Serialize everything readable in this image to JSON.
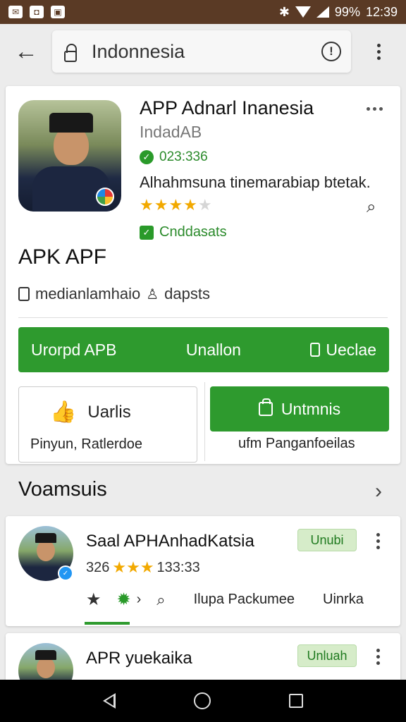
{
  "status_bar": {
    "left_icons": [
      "notification-icon",
      "photo-icon",
      "message-icon"
    ],
    "battery": "99%",
    "time": "12:39"
  },
  "appbar": {
    "search_text": "Indonnesia"
  },
  "app": {
    "title": "APP Adnarl Inanesia",
    "subtitle": "IndadAB",
    "verified_text": "023:336",
    "description": "Alhahmsuna tinemarabiap btetak.",
    "rating": 4,
    "rating_max": 5,
    "check_tag": "Cnddasats",
    "apk_label": "APK APF",
    "meta_text": "medianlamhaio",
    "meta_person": "dapsts"
  },
  "green_bar": {
    "left": "Urorpd APB",
    "center": "Unallon",
    "right": "Ueclae"
  },
  "buttons": {
    "outline_label": "Uarlis",
    "outline_sub": "Pinyun, Ratlerdoe",
    "fill_label": "Untmnis",
    "fill_sub": "ufm Panganfoeilas"
  },
  "section": {
    "title": "Voamsuis"
  },
  "list": [
    {
      "title": "Saal APHAnhadKatsia",
      "pill": "Unubi",
      "rating_num": "326",
      "rating_extra": "133:33",
      "action_text_1": "Ilupa Packumee",
      "action_text_2": "Uinrka"
    },
    {
      "title": "APR yuekaika",
      "pill": "Unluah"
    }
  ],
  "colors": {
    "green": "#2e9a2e",
    "status_bar": "#5a3a25",
    "star": "#f2a900"
  }
}
